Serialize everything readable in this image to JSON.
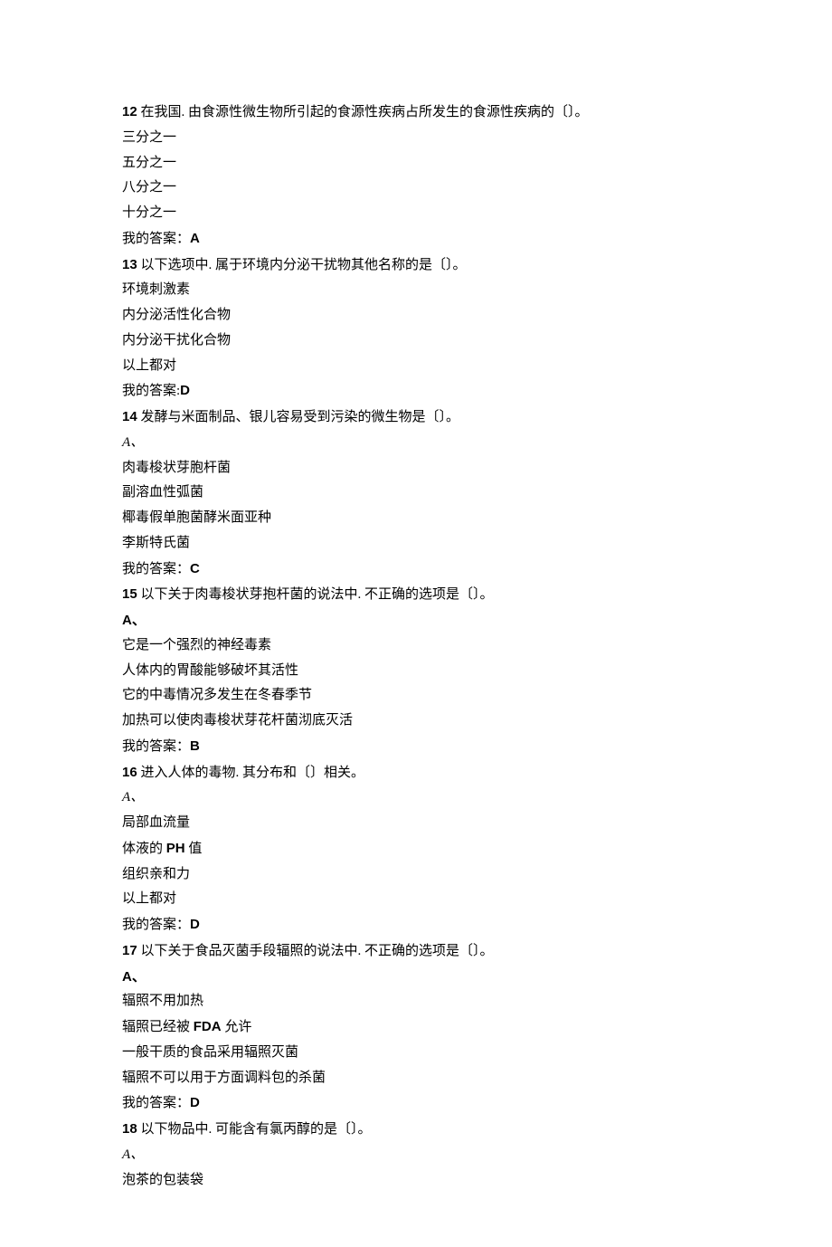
{
  "q12": {
    "num": "12",
    "stem_rest": " 在我国. 由食源性微生物所引起的食源性疾病占所发生的食源性疾病的〔〕。",
    "opts": [
      "三分之一",
      "五分之一",
      "八分之一",
      "十分之一"
    ],
    "ans_label": "我的答案：",
    "ans_val": "A"
  },
  "q13": {
    "num": "13",
    "stem_rest": " 以下选项中. 属于环境内分泌干扰物其他名称的是〔〕。",
    "opts": [
      "环境刺激素",
      "内分泌活性化合物",
      "内分泌干扰化合物",
      "以上都对"
    ],
    "ans_label": "我的答案:",
    "ans_val": "D"
  },
  "q14": {
    "num": "14",
    "stem_rest": " 发酵与米面制品、银儿容易受到污染的微生物是〔〕。",
    "sub": "A、",
    "opts": [
      "肉毒梭状芽胞杆菌",
      "副溶血性弧菌",
      "椰毒假单胞菌酵米面亚种",
      "李斯特氏菌"
    ],
    "ans_label": "我的答案：",
    "ans_val": "C"
  },
  "q15": {
    "num": "15",
    "stem_rest": " 以下关于肉毒梭状芽抱杆菌的说法中. 不正确的选项是〔〕。",
    "sub": "A、",
    "opts": [
      "它是一个强烈的神经毒素",
      "人体内的胃酸能够破坏其活性",
      "它的中毒情况多发生在冬春季节",
      "加热可以使肉毒梭状芽花杆菌沏底灭活"
    ],
    "ans_label": "我的答案：",
    "ans_val": "B"
  },
  "q16": {
    "num": "16",
    "stem_rest": " 进入人体的毒物. 其分布和〔〕相关。",
    "sub": "A、",
    "opts_pre_ph": "体液的 ",
    "opts_ph": "PH",
    "opts_post_ph": " 值",
    "opts": [
      "局部血流量",
      null,
      "组织亲和力",
      "以上都对"
    ],
    "ans_label": "我的答案：",
    "ans_val": "D"
  },
  "q17": {
    "num": "17",
    "stem_rest": " 以下关于食品灭菌手段辐照的说法中. 不正确的选项是〔〕。",
    "sub": "A、",
    "opts_fda_pre": "辐照已经被 ",
    "opts_fda_b": "FDA",
    "opts_fda_post": " 允许",
    "opts": [
      "辐照不用加热",
      null,
      "一般干质的食品采用辐照灭菌",
      "辐照不可以用于方面调料包的杀菌"
    ],
    "ans_label": "我的答案：",
    "ans_val": "D"
  },
  "q18": {
    "num": "18",
    "stem_rest": " 以下物品中. 可能含有氯丙醇的是〔〕。",
    "sub": "A、",
    "opts": [
      "泡茶的包装袋"
    ]
  }
}
